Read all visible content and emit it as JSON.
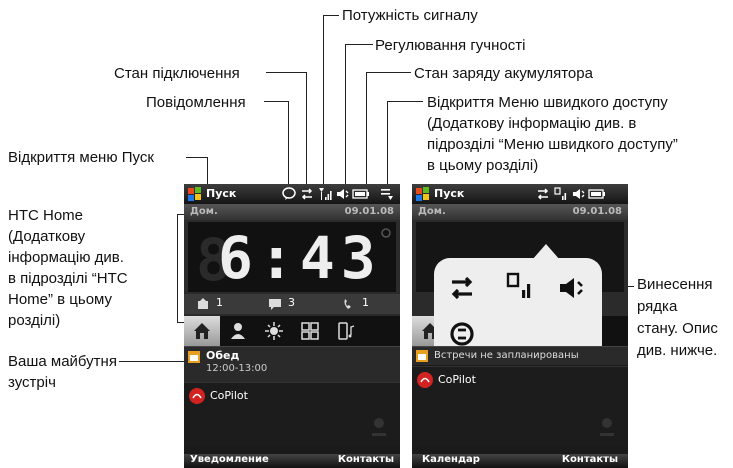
{
  "annotations": {
    "signal": "Потужність сигналу",
    "volume": "Регулювання гучності",
    "connection": "Стан підключення",
    "battery": "Стан заряду акумулятора",
    "messages": "Повідомлення",
    "quick_menu_1": "Відкриття Меню швидкого доступу",
    "quick_menu_2": "(Додаткову інформацію див. в",
    "quick_menu_3": "підрозділі “Меню швидкого доступу”",
    "quick_menu_4": "в цьому розділі)",
    "start_menu": "Відкриття меню Пуск",
    "htc_home_1": "HTC Home",
    "htc_home_2": "(Додаткову",
    "htc_home_3": "інформацію див.",
    "htc_home_4": "в підрозділі “HTC",
    "htc_home_5": "Home” в цьому",
    "htc_home_6": "розділі)",
    "upcoming_1": "Ваша майбутня",
    "upcoming_2": "зустріч",
    "status_callout_1": "Винесення",
    "status_callout_2": "рядка",
    "status_callout_3": "стану. Опис",
    "status_callout_4": "див. нижче."
  },
  "left_phone": {
    "start_label": "Пуск",
    "home_label": "Дом.",
    "date": "09.01.08",
    "time": "6:43",
    "counts": [
      "1",
      "3",
      "1"
    ],
    "appointment_title": "Обед",
    "appointment_time": "12:00-13:00",
    "app_name": "CoPilot",
    "soft_left": "Уведомление",
    "soft_right": "Контакты"
  },
  "right_phone": {
    "start_label": "Пуск",
    "home_label": "Дом.",
    "date": "09.01.08",
    "appointment_text": "Встречи не запланированы",
    "app_name": "CoPilot",
    "soft_left": "Календар",
    "soft_right": "Контакты"
  },
  "colors": {
    "accent_clock": "#eeeeee",
    "copilot_red": "#d22222",
    "start_flag": "#e8a020"
  }
}
